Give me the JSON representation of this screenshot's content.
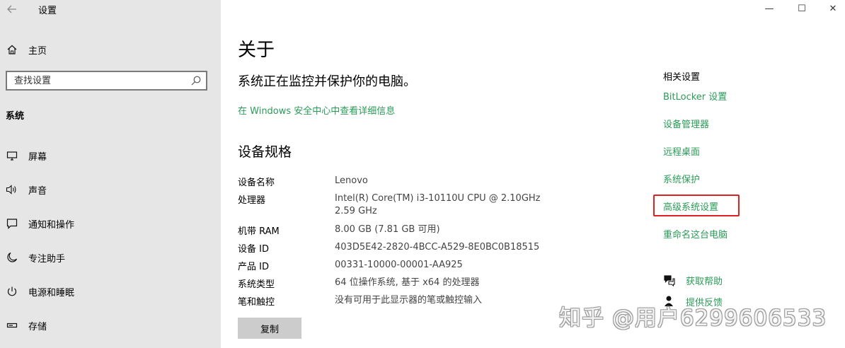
{
  "window": {
    "title": "设置",
    "controls": {
      "minimize": "—",
      "maximize": "☐",
      "close": "✕"
    }
  },
  "sidebar": {
    "home_label": "主页",
    "search_placeholder": "查找设置",
    "section_header": "系统",
    "items": [
      {
        "label": "屏幕",
        "icon": "display-icon"
      },
      {
        "label": "声音",
        "icon": "speaker-icon"
      },
      {
        "label": "通知和操作",
        "icon": "notification-icon"
      },
      {
        "label": "专注助手",
        "icon": "moon-icon"
      },
      {
        "label": "电源和睡眠",
        "icon": "power-icon"
      },
      {
        "label": "存储",
        "icon": "storage-icon"
      }
    ]
  },
  "main": {
    "title": "关于",
    "status": "系统正在监控并保护你的电脑。",
    "security_link": "在 Windows 安全中心中查看详细信息",
    "spec_title": "设备规格",
    "specs": [
      {
        "label": "设备名称",
        "value": "Lenovo"
      },
      {
        "label": "处理器",
        "value": "Intel(R) Core(TM) i3-10110U CPU @ 2.10GHz   2.59 GHz"
      },
      {
        "label": "机带 RAM",
        "value": "8.00 GB (7.81 GB 可用)"
      },
      {
        "label": "设备 ID",
        "value": "403D5E42-2820-4BCC-A529-8E0BC0B18515"
      },
      {
        "label": "产品 ID",
        "value": "00331-10000-00001-AA925"
      },
      {
        "label": "系统类型",
        "value": "64 位操作系统, 基于 x64 的处理器"
      },
      {
        "label": "笔和触控",
        "value": "没有可用于此显示器的笔或触控输入"
      }
    ],
    "copy_button": "复制"
  },
  "related": {
    "title": "相关设置",
    "links": [
      "BitLocker 设置",
      "设备管理器",
      "远程桌面",
      "系统保护",
      "高级系统设置",
      "重命名这台电脑"
    ],
    "highlighted_link": "高级系统设置",
    "help": "获取帮助",
    "feedback": "提供反馈"
  },
  "watermark": "知乎 @用户6299606533",
  "colors": {
    "sidebar_bg": "#e6e6e6",
    "link": "#2a9b57",
    "highlight_border": "#e02020",
    "button_bg": "#cccccc"
  }
}
